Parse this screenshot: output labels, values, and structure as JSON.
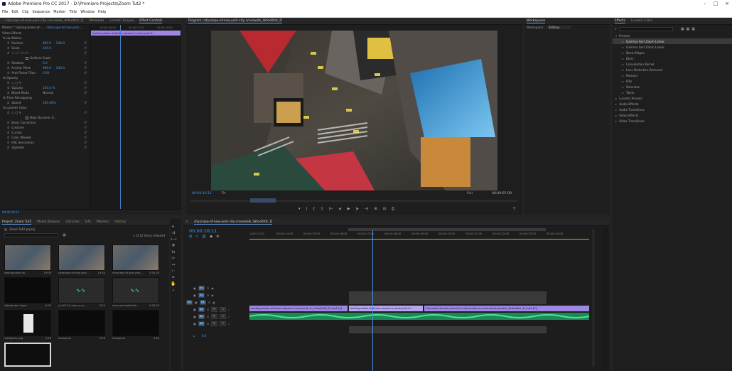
{
  "window": {
    "title": "Adobe Premiere Pro CC 2017 - D:\\Premiere Projects\\Zoom Tut2 *",
    "controls": [
      "–",
      "□",
      "×"
    ]
  },
  "menu": [
    "File",
    "Edit",
    "Clip",
    "Sequence",
    "Marker",
    "Title",
    "Window",
    "Help"
  ],
  "source_tabs": {
    "tabs": [
      "...cityscape-of-new-york-city-crosswalk_4kfoo6fdc_D",
      "Metadata",
      "Lumetri Scopes",
      "Effect Controls"
    ],
    "active": "Effect Controls"
  },
  "effect_controls": {
    "master": "Master * looking-down-at-...",
    "sequence": "cityscape-of-new-york-...",
    "section": "Video Effects",
    "clip_label": "looking-down-at-times-square-in-new-york-fr...",
    "timecodes": [
      "00:00:16:00",
      "00:00:17:00",
      "00:00:18:00"
    ],
    "rows": [
      {
        "label": "fx  ⊡▸ Motion",
        "indent": 4
      },
      {
        "label": "Position",
        "indent": 10,
        "values": [
          "960.0",
          "540.0"
        ]
      },
      {
        "label": "Scale",
        "indent": 10,
        "values": [
          "100.0"
        ]
      },
      {
        "label": "Scale Width",
        "indent": 10,
        "values": [],
        "dim": true
      },
      {
        "label": "Uniform Scale",
        "indent": 36,
        "checkbox": true
      },
      {
        "label": "Rotation",
        "indent": 10,
        "values": [
          "0.0"
        ]
      },
      {
        "label": "Anchor Point",
        "indent": 10,
        "values": [
          "960.0",
          "540.0"
        ]
      },
      {
        "label": "Anti-flicker Filter",
        "indent": 10,
        "values": [
          "0.00"
        ]
      },
      {
        "label": "fx  Opacity",
        "indent": 4
      },
      {
        "label": "○ □ ✎",
        "indent": 10
      },
      {
        "label": "Opacity",
        "indent": 10,
        "values": [
          "100.0 %"
        ]
      },
      {
        "label": "Blend Mode",
        "indent": 10,
        "values": [
          "Normal"
        ]
      },
      {
        "label": "fx  Time Remapping",
        "indent": 4
      },
      {
        "label": "Speed",
        "indent": 10,
        "values": [
          "100.00%"
        ]
      },
      {
        "label": "fx  Lumetri Color",
        "indent": 4
      },
      {
        "label": "○ □ ✎",
        "indent": 10
      },
      {
        "label": "High Dynamic R...",
        "indent": 36,
        "checkbox": true
      },
      {
        "label": "Basic Correction",
        "indent": 10
      },
      {
        "label": "Creative",
        "indent": 10
      },
      {
        "label": "Curves",
        "indent": 10
      },
      {
        "label": "Color Wheels",
        "indent": 10
      },
      {
        "label": "HSL Secondary",
        "indent": 10
      },
      {
        "label": "Vignette",
        "indent": 10
      }
    ],
    "footer_time": "00:00:16:11"
  },
  "program": {
    "tab": "Program: cityscape-of-new-york-city-crosswalk_4kfoo6fdc_D",
    "current_time": "00:00:16:11",
    "fit": "Fit",
    "quality": "Full",
    "duration": "00:00:07:09",
    "controls": [
      "▾",
      "|",
      "{",
      "}",
      "|←",
      "◂|",
      "▶",
      "|▸",
      "→|",
      "⊞",
      "⊟",
      "⎙"
    ],
    "add": "+"
  },
  "workspaces": {
    "tab": "Workspaces",
    "label": "Workspace:",
    "value": "Editing"
  },
  "effects": {
    "tabs": [
      "Effects",
      "Lumetri Color"
    ],
    "active": "Effects",
    "search_placeholder": "",
    "items": [
      {
        "label": "Presets",
        "level": 0,
        "open": true
      },
      {
        "label": "Gamma Fast Zoom Linear",
        "level": 1,
        "selected": true
      },
      {
        "label": "Gamma Fast Zoom Linear",
        "level": 1
      },
      {
        "label": "Bevel Edges",
        "level": 1
      },
      {
        "label": "Blurs",
        "level": 1
      },
      {
        "label": "Convolution Kernel",
        "level": 1
      },
      {
        "label": "Lens Distortion Removal",
        "level": 1
      },
      {
        "label": "Mosaics",
        "level": 1
      },
      {
        "label": "PiPs",
        "level": 1
      },
      {
        "label": "Solarizes",
        "level": 1
      },
      {
        "label": "Twirls",
        "level": 1
      },
      {
        "label": "Lumetri Presets",
        "level": 0
      },
      {
        "label": "Audio Effects",
        "level": 0
      },
      {
        "label": "Audio Transitions",
        "level": 0
      },
      {
        "label": "Video Effects",
        "level": 0
      },
      {
        "label": "Video Transitions",
        "level": 0
      }
    ]
  },
  "project": {
    "tabs": [
      "Project: Zoom Tut2",
      "Media Browser",
      "Libraries",
      "Info",
      "Markers",
      "History"
    ],
    "active": "Project: Zoom Tut2",
    "file": "Zoom Tut2.prproj",
    "count": "1 of 12 items selected",
    "items": [
      {
        "name": "looking-down-at-...",
        "dur": "19:08",
        "kind": "city"
      },
      {
        "name": "cityscape-of-new-york-...",
        "dur": "14:54",
        "kind": "city"
      },
      {
        "name": "cityscape-of-new-york-...",
        "dur": "5:05:28",
        "kind": "city"
      },
      {
        "name": "Adjustment Layer",
        "dur": "9:26",
        "kind": "black"
      },
      {
        "name": "yt-0013-it-why-ur-sn...",
        "dur": "9:29",
        "kind": "audio"
      },
      {
        "name": "new-york-radio-ble...",
        "dur": "5:05:28",
        "kind": "audio"
      },
      {
        "name": "instagram.png",
        "dur": "9:26",
        "kind": "image"
      },
      {
        "name": "Instagram",
        "dur": "9:26",
        "kind": "black"
      },
      {
        "name": "Instagram",
        "dur": "9:26",
        "kind": "black"
      },
      {
        "name": "",
        "dur": "",
        "kind": "selected"
      }
    ]
  },
  "timeline": {
    "tab": "cityscape-of-new-york-city-crosswalk_4kfoo6fdc_D",
    "current_time": "00:00:16:11",
    "ruler": [
      "1:00:13:00",
      "00:00:14:00",
      "00:00:15:00",
      "00:00:16:00",
      "00:00:17:00",
      "00:00:18:00",
      "00:00:19:00",
      "00:00:20:00",
      "00:00:21:00",
      "00:00:22:00",
      "00:00:23:00",
      "00:00:24:00"
    ],
    "tracks": [
      "V3",
      "V2",
      "V1",
      "A1",
      "A2",
      "A3"
    ],
    "source_patch": "V1",
    "clips": [
      "Looking-down-at-times-square-in-new-york-fr_sHaaSJ4W_D.mp4 [V]",
      "looking-down-at-times-square-in-new-york-fr...",
      "cityscape-of-new-york-city-intersection-in-new-times-square_4kfoo6fdc_D.mp4 [V]"
    ],
    "master_value": "0.0"
  }
}
